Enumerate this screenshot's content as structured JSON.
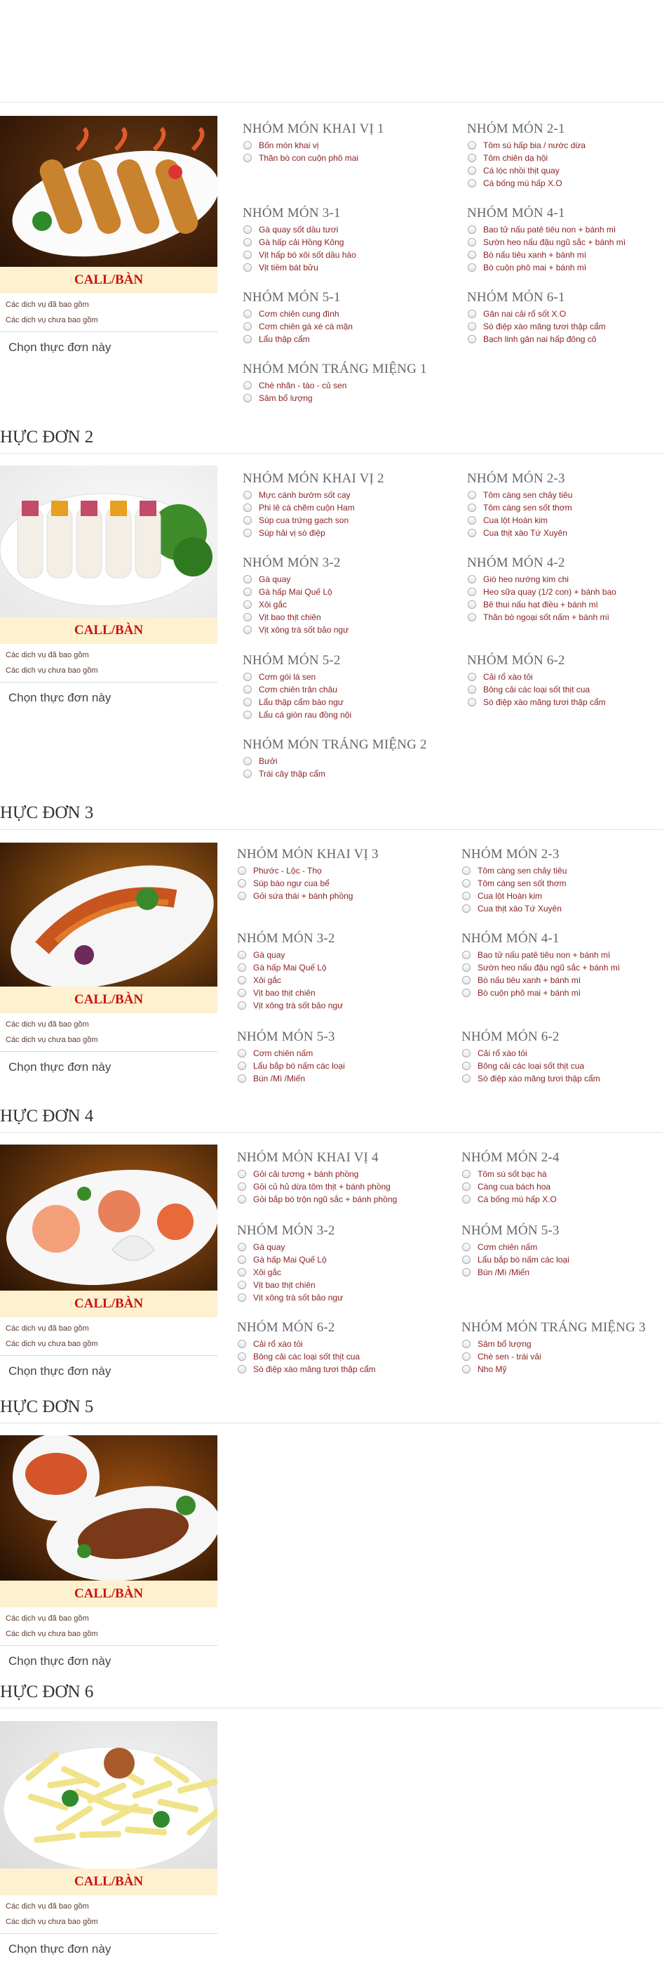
{
  "common": {
    "call_label": "CALL/BÀN",
    "note_included": "Các dịch vụ đã bao gồm",
    "note_excluded": "Các dịch vụ chưa bao gồm",
    "choose_label": "Chọn thực đơn này"
  },
  "colors": {
    "call_text": "#cc1111",
    "call_bg": "#fdf1cf",
    "item_text": "#8a1f1f",
    "heading": "#666666"
  },
  "menus": [
    {
      "title": "",
      "image": "crispy-shrimp-rolls-image",
      "groups": [
        {
          "title": "NHÓM MÓN KHAI VỊ 1",
          "items": [
            "Bốn món khai vị",
            "Thăn bò con cuộn phô mai"
          ]
        },
        {
          "title": "NHÓM MÓN 2-1",
          "items": [
            "Tôm sú hấp bia / nước dừa",
            "Tôm chiên dạ hội",
            "Cá lóc nhồi thịt quay",
            "Cá bống mú hấp X.O"
          ]
        },
        {
          "title": "NHÓM MÓN 3-1",
          "items": [
            "Gà quay sốt dầu tươi",
            "Gà hấp cải Hồng Kông",
            "Vịt hấp bó xôi sốt dầu hào",
            "Vịt tiềm bát bửu"
          ]
        },
        {
          "title": "NHÓM MÓN 4-1",
          "items": [
            "Bao tử nấu patê tiêu non + bánh mì",
            "Sườn heo nấu đậu ngũ sắc + bánh mì",
            "Bò nấu tiêu xanh + bánh mì",
            "Bò cuộn phô mai + bánh mì"
          ]
        },
        {
          "title": "NHÓM MÓN 5-1",
          "items": [
            "Cơm chiên cung đình",
            "Cơm chiên gà xé cá mặn",
            "Lẩu thập cẩm"
          ]
        },
        {
          "title": "NHÓM MÓN 6-1",
          "items": [
            "Gân nai cải rổ sốt X.O",
            "Sò điệp xào măng tươi thập cẩm",
            "Bạch linh gân nai hấp đông cô"
          ]
        },
        {
          "title": "NHÓM MÓN TRÁNG MIỆNG 1",
          "items": [
            "Chè nhãn - táo - củ sen",
            "Sâm bổ lượng"
          ]
        }
      ]
    },
    {
      "title": "HỰC ĐƠN 2",
      "image": "fresh-spring-rolls-image",
      "groups": [
        {
          "title": "NHÓM MÓN KHAI VỊ 2",
          "items": [
            "Mực cánh bướm sốt cay",
            "Phi lê cá chẽm cuộn Ham",
            "Súp cua trứng gạch son",
            "Súp hải vị sò điệp"
          ]
        },
        {
          "title": "NHÓM MÓN 2-3",
          "items": [
            "Tôm càng sen chảy tiêu",
            "Tôm càng sen sốt thơm",
            "Cua lột Hoàn kim",
            "Cua thịt xào Tứ Xuyên"
          ]
        },
        {
          "title": "NHÓM MÓN 3-2",
          "items": [
            "Gà quay",
            "Gà hấp Mai Quế Lộ",
            "Xôi gắc",
            "Vịt bao thịt chiên",
            "Vịt xông trà sốt bảo ngư"
          ]
        },
        {
          "title": "NHÓM MÓN 4-2",
          "items": [
            "Giò heo nướng kim chi",
            "Heo sữa quay (1/2 con) + bánh bao",
            "Bê thui nấu hạt điều + bánh mì",
            "Thăn bò ngoại sốt nấm + bánh mì"
          ]
        },
        {
          "title": "NHÓM MÓN 5-2",
          "items": [
            "Cơm gói lá sen",
            "Cơm chiên trân châu",
            "Lẩu thập cẩm bào ngư",
            "Lẩu cá giòn rau đồng nội"
          ]
        },
        {
          "title": "NHÓM MÓN 6-2",
          "items": [
            "Cải rổ xào tỏi",
            "Bông cải các loại sốt thịt cua",
            "Sò điệp xào măng tươi thập cẩm"
          ]
        },
        {
          "title": "NHÓM MÓN TRÁNG MIỆNG 2",
          "items": [
            "Bưởi",
            "Trái cây thập cẩm"
          ]
        }
      ]
    },
    {
      "title": "HỰC ĐƠN 3",
      "image": "seafood-salad-image",
      "groups": [
        {
          "title": "NHÓM MÓN KHAI VỊ 3",
          "items": [
            "Phước - Lộc - Thọ",
            "Súp bào ngư cua bể",
            "Gỏi sứa thái + bánh phồng"
          ]
        },
        {
          "title": "NHÓM MÓN 2-3",
          "items": [
            "Tôm càng sen chảy tiêu",
            "Tôm càng sen sốt thơm",
            "Cua lột Hoàn kim",
            "Cua thịt xào Tứ Xuyên"
          ]
        },
        {
          "title": "NHÓM MÓN 3-2",
          "items": [
            "Gà quay",
            "Gà hấp Mai Quế Lộ",
            "Xôi gắc",
            "Vịt bao thịt chiên",
            "Vịt xông trà sốt bảo ngư"
          ]
        },
        {
          "title": "NHÓM MÓN 4-1",
          "items": [
            "Bao tử nấu patê tiêu non + bánh mì",
            "Sườn heo nấu đậu ngũ sắc + bánh mì",
            "Bò nấu tiêu xanh + bánh mì",
            "Bò cuộn phô mai + bánh mì"
          ]
        },
        {
          "title": "NHÓM MÓN 5-3",
          "items": [
            "Cơm chiên nấm",
            "Lẩu bắp bò nấm các loại",
            "Bún /Mì /Miến"
          ]
        },
        {
          "title": "NHÓM MÓN 6-2",
          "items": [
            "Cải rổ xào tỏi",
            "Bông cải các loại sốt thịt cua",
            "Sò điệp xào măng tươi thập cẩm"
          ]
        }
      ]
    },
    {
      "title": "HỰC ĐƠN 4",
      "image": "seafood-platter-image",
      "groups": [
        {
          "title": "NHÓM MÓN KHAI VỊ 4",
          "items": [
            "Gỏi cải tương + bánh phồng",
            "Gỏi củ hủ dừa tôm thịt + bánh phồng",
            "Gỏi bắp bò trộn ngũ sắc + bánh phồng"
          ]
        },
        {
          "title": "NHÓM MÓN 2-4",
          "items": [
            "Tôm sú sốt bạc hà",
            "Càng cua bách hoa",
            "Cá bống mú hấp X.O"
          ]
        },
        {
          "title": "NHÓM MÓN 3-2",
          "items": [
            "Gà quay",
            "Gà hấp Mai Quế Lộ",
            "Xôi gắc",
            "Vịt bao thịt chiên",
            "Vịt xông trà sốt bảo ngư"
          ]
        },
        {
          "title": "NHÓM MÓN 5-3",
          "items": [
            "Cơm chiên nấm",
            "Lẩu bắp bò nấm các loại",
            "Bún /Mì /Miến"
          ]
        },
        {
          "title": "NHÓM MÓN 6-2",
          "items": [
            "Cải rổ xào tỏi",
            "Bông cải các loại sốt thịt cua",
            "Sò điệp xào măng tươi thập cẩm"
          ]
        },
        {
          "title": "NHÓM MÓN TRÁNG MIỆNG 3",
          "items": [
            "Sâm bổ lượng",
            "Chè sen - trái vải",
            "Nho Mỹ"
          ]
        }
      ]
    },
    {
      "title": "HỰC ĐƠN 5",
      "image": "roast-duck-image",
      "groups": []
    },
    {
      "title": "HỰC ĐƠN 6",
      "image": "green-papaya-salad-image",
      "groups": []
    }
  ]
}
